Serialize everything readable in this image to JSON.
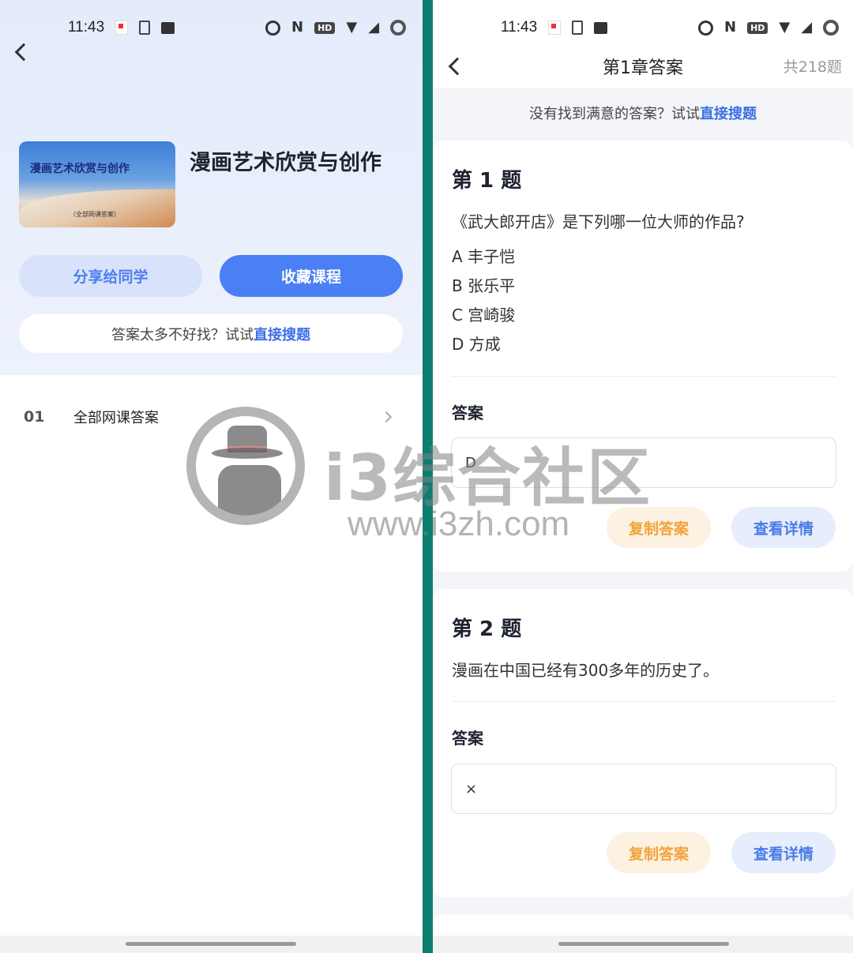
{
  "left": {
    "status": {
      "time": "11:43"
    },
    "course": {
      "cover_title": "漫画艺术欣赏与创作",
      "cover_subtitle": "（全部网课答案）",
      "title": "漫画艺术欣赏与创作"
    },
    "buttons": {
      "share": "分享给同学",
      "collect": "收藏课程"
    },
    "hint": {
      "text": "答案太多不好找？试试",
      "link": "直接搜题"
    },
    "list": [
      {
        "num": "01",
        "name": "全部网课答案"
      }
    ]
  },
  "right": {
    "status": {
      "time": "11:43"
    },
    "header": {
      "title": "第1章答案",
      "count": "共218题"
    },
    "hint": {
      "text": "没有找到满意的答案？试试",
      "link": "直接搜题"
    },
    "questions": [
      {
        "num": "第 1 题",
        "text": "《武大郎开店》是下列哪一位大师的作品?",
        "options": [
          "A 丰子恺",
          "B 张乐平",
          "C  宫崎骏",
          "D 方成"
        ],
        "answer_label": "答案",
        "answer": "D",
        "copy": "复制答案",
        "detail": "查看详情"
      },
      {
        "num": "第 2 题",
        "text": "漫画在中国已经有300多年的历史了。",
        "options": [],
        "answer_label": "答案",
        "answer": "×",
        "copy": "复制答案",
        "detail": "查看详情"
      }
    ]
  },
  "watermark": {
    "text": "i3综合社区",
    "url": "www.i3zh.com"
  },
  "colors": {
    "accent": "#4a80f3",
    "divider": "#0d7d72",
    "copy": "#f2a33a"
  }
}
